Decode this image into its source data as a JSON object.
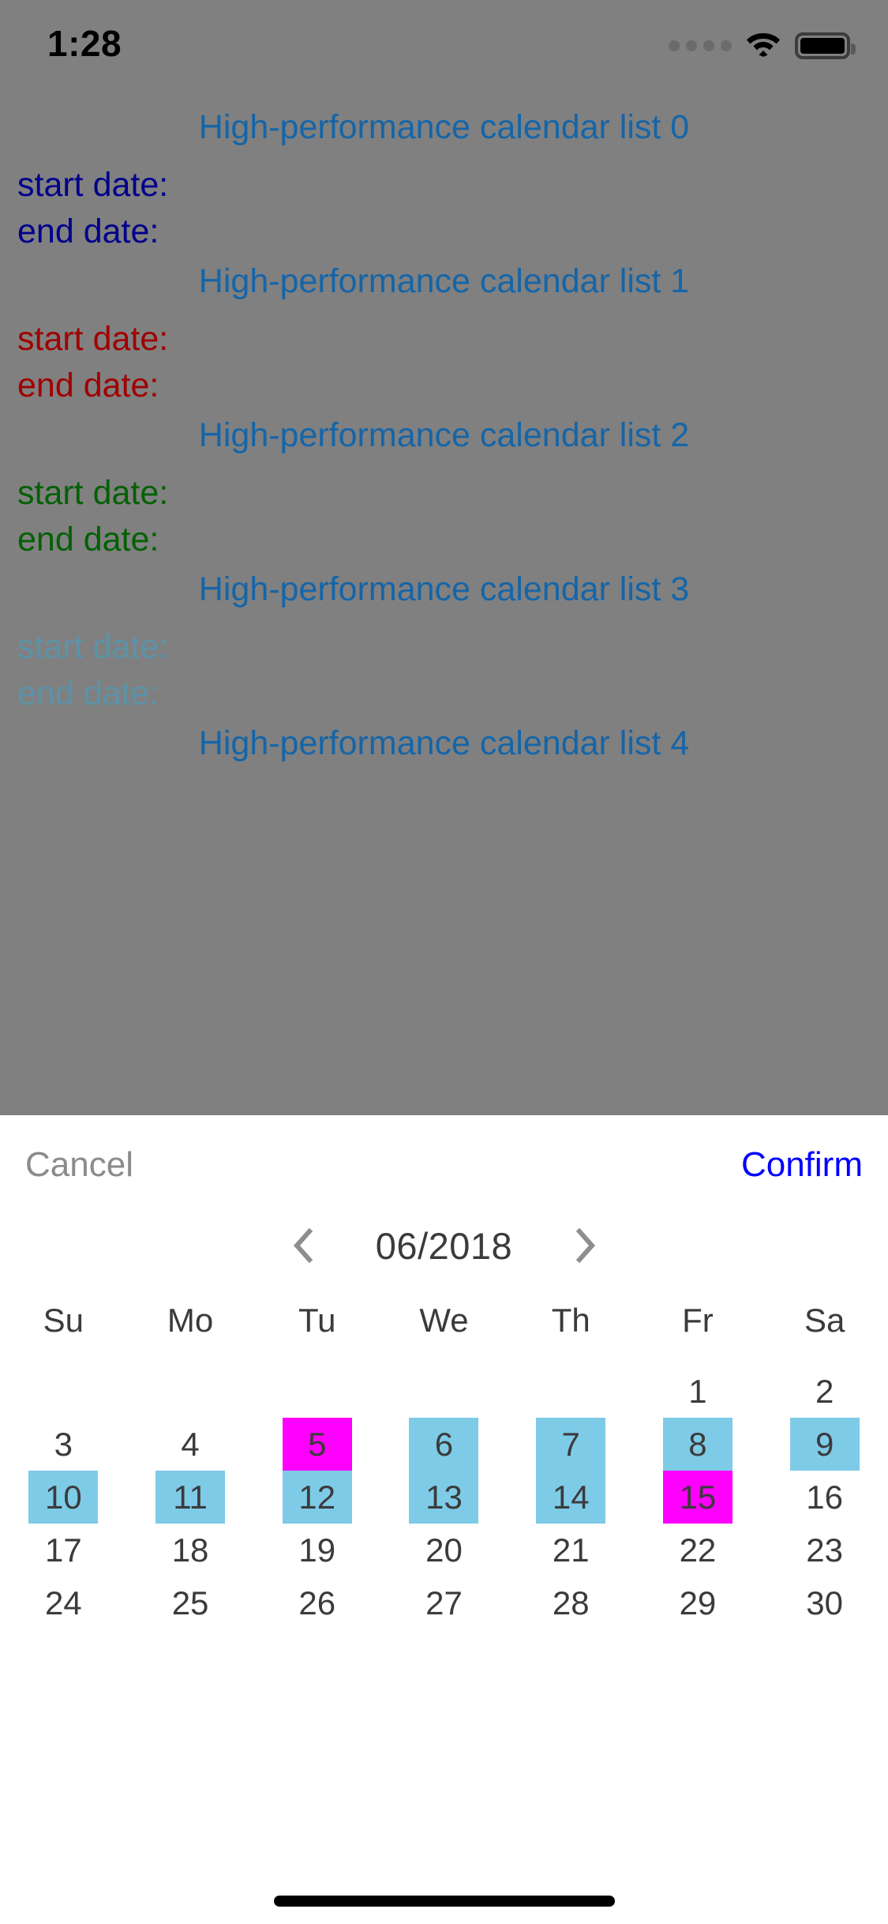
{
  "status_bar": {
    "time": "1:28",
    "signal_icon": "signal-dots-icon",
    "wifi_icon": "wifi-icon",
    "battery_icon": "battery-full-icon"
  },
  "background_app": {
    "sections": [
      {
        "title": "High-performance calendar list 0",
        "start_label": "start date:",
        "end_label": "end date:",
        "color": "#00008b"
      },
      {
        "title": "High-performance calendar list 1",
        "start_label": "start date:",
        "end_label": "end date:",
        "color": "#a00000"
      },
      {
        "title": "High-performance calendar list 2",
        "start_label": "start date:",
        "end_label": "end date:",
        "color": "#046004"
      },
      {
        "title": "High-performance calendar list 3",
        "start_label": "start date:",
        "end_label": "end date:",
        "color": "#5b93a8"
      },
      {
        "title": "High-performance calendar list 4",
        "start_label": "",
        "end_label": "",
        "color": "#1565a8"
      }
    ],
    "title_color": "#1565a8"
  },
  "sheet": {
    "cancel_label": "Cancel",
    "confirm_label": "Confirm",
    "cancel_color": "#8b8b8b",
    "confirm_color": "#0000ff",
    "month_label": "06/2018",
    "prev_icon": "chevron-left-icon",
    "next_icon": "chevron-right-icon",
    "weekdays": [
      "Su",
      "Mo",
      "Tu",
      "We",
      "Th",
      "Fr",
      "Sa"
    ],
    "leading_blanks": 5,
    "days": [
      {
        "n": "1",
        "state": "plain"
      },
      {
        "n": "2",
        "state": "plain"
      },
      {
        "n": "3",
        "state": "plain"
      },
      {
        "n": "4",
        "state": "plain"
      },
      {
        "n": "5",
        "state": "edge"
      },
      {
        "n": "6",
        "state": "inrange"
      },
      {
        "n": "7",
        "state": "inrange"
      },
      {
        "n": "8",
        "state": "inrange"
      },
      {
        "n": "9",
        "state": "inrange"
      },
      {
        "n": "10",
        "state": "inrange"
      },
      {
        "n": "11",
        "state": "inrange"
      },
      {
        "n": "12",
        "state": "inrange"
      },
      {
        "n": "13",
        "state": "inrange"
      },
      {
        "n": "14",
        "state": "inrange"
      },
      {
        "n": "15",
        "state": "edge"
      },
      {
        "n": "16",
        "state": "plain"
      },
      {
        "n": "17",
        "state": "plain"
      },
      {
        "n": "18",
        "state": "plain"
      },
      {
        "n": "19",
        "state": "plain"
      },
      {
        "n": "20",
        "state": "plain"
      },
      {
        "n": "21",
        "state": "plain"
      },
      {
        "n": "22",
        "state": "plain"
      },
      {
        "n": "23",
        "state": "plain"
      },
      {
        "n": "24",
        "state": "plain"
      },
      {
        "n": "25",
        "state": "plain"
      },
      {
        "n": "26",
        "state": "plain"
      },
      {
        "n": "27",
        "state": "plain"
      },
      {
        "n": "28",
        "state": "plain"
      },
      {
        "n": "29",
        "state": "plain"
      },
      {
        "n": "30",
        "state": "plain"
      }
    ],
    "range_color": "#7ecbe8",
    "edge_color": "#ff00ff",
    "selected_start": "5",
    "selected_end": "15"
  },
  "home_indicator": "home-indicator"
}
